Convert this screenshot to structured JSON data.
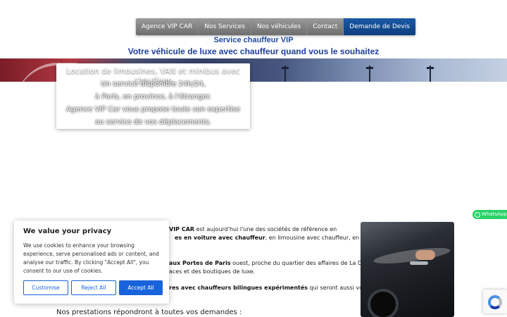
{
  "nav": {
    "items": [
      "Agence VIP CAR",
      "Nos Services",
      "Nos véhicules",
      "Contact"
    ],
    "cta": "Demande de Devis"
  },
  "header": {
    "subtitle1": "Service chauffeur VIP",
    "subtitle2": "Votre véhicule de luxe avec chauffeur quand vous le souhaitez"
  },
  "hero": {
    "title": "Location de limousines, VAN et minibus avec chauffeur.",
    "lines": [
      "Un service disponible 24h/24,",
      "à Paris, en province, à l'étranger.",
      "Agence VIP Car vous propose toute son expertise",
      "au service de vos déplacements."
    ]
  },
  "content": {
    "p1_a": "VIP CAR",
    "p1_b": " est aujourd'hui l'une des sociétés de référence en",
    "p1_c": "es en voiture avec chauffeur",
    "p1_d": ", en limousine avec chauffeur, en VAN et",
    "p2_a": "aux Portes de Paris",
    "p2_b": " ouest, proche du quartier des affaires de La Défense et",
    "p2_c": "aces et des boutiques de luxe.",
    "p3_a": "res avec chauffeurs bilingues expérimentés",
    "p3_b": " qui seront aussi vos guides et",
    "prestations_heading": "Nos prestations répondront à toutes vos demandes :"
  },
  "whatsapp": {
    "label": "WhatsApp"
  },
  "cookie": {
    "title": "We value your privacy",
    "text": "We use cookies to enhance your browsing experience, serve personalised ads or content, and analyse our traffic. By clicking \"Accept All\", you consent to our use of cookies.",
    "customise": "Customise",
    "reject": "Reject All",
    "accept": "Accept All"
  },
  "colors": {
    "nav_bg": "#7f7f7f",
    "cta_bg": "#0e3f7e",
    "heading_blue": "#1e4aa0",
    "cookie_accent": "#1863dc",
    "whatsapp": "#25d366"
  }
}
